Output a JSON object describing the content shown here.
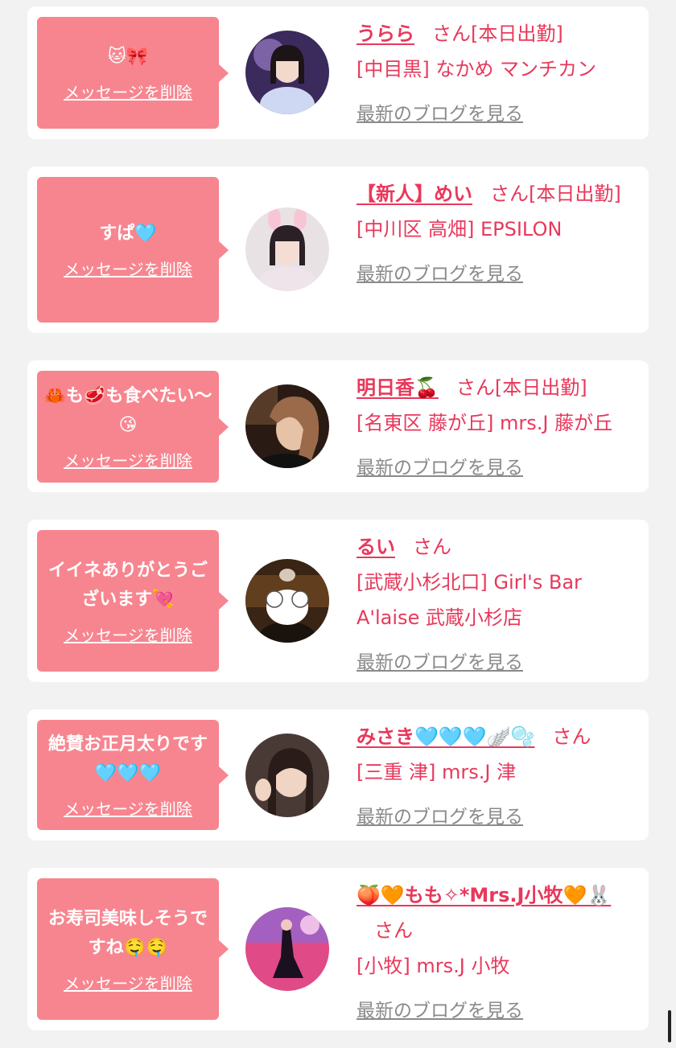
{
  "cards": [
    {
      "message": "🐱🎀",
      "delete_label": "メッセージを削除",
      "name": "うらら",
      "suffix": "さん",
      "status": "[本日出勤]",
      "location": "[中目黒] なかめ マンチカン",
      "blog_link": "最新のブログを見る"
    },
    {
      "message": "すぱ🩵",
      "delete_label": "メッセージを削除",
      "name": "【新人】めい",
      "suffix": "さん",
      "status": "[本日出勤]",
      "location": "[中川区 高畑] EPSILON",
      "blog_link": "最新のブログを見る"
    },
    {
      "message": "🦀も🥩も食べたい〜😘",
      "delete_label": "メッセージを削除",
      "name": "明日香🍒",
      "suffix": "さん",
      "status": "[本日出勤]",
      "location": "[名東区 藤が丘] mrs.J 藤が丘",
      "blog_link": "最新のブログを見る"
    },
    {
      "message": "イイネありがとうございます💘",
      "delete_label": "メッセージを削除",
      "name": "るい",
      "suffix": "さん",
      "status": "",
      "location": "[武蔵小杉北口] Girl's Bar A'laise 武蔵小杉店",
      "blog_link": "最新のブログを見る"
    },
    {
      "message": "絶賛お正月太りです🩵🩵🩵",
      "delete_label": "メッセージを削除",
      "name": "みさき🩵🩵🩵🪽🫧",
      "suffix": "さん",
      "status": "",
      "location": "[三重 津] mrs.J 津",
      "blog_link": "最新のブログを見る"
    },
    {
      "message": "お寿司美味しそうですね🤤🤤",
      "delete_label": "メッセージを削除",
      "name": "🍑🧡もも✧*Mrs.J小牧🧡🐰",
      "suffix": "さん",
      "status": "",
      "location": "[小牧] mrs.J 小牧",
      "blog_link": "最新のブログを見る"
    }
  ],
  "colors": {
    "bubble": "#f7858f",
    "accent": "#e8385b",
    "muted": "#8a8a8a",
    "background": "#f2f2f3"
  }
}
